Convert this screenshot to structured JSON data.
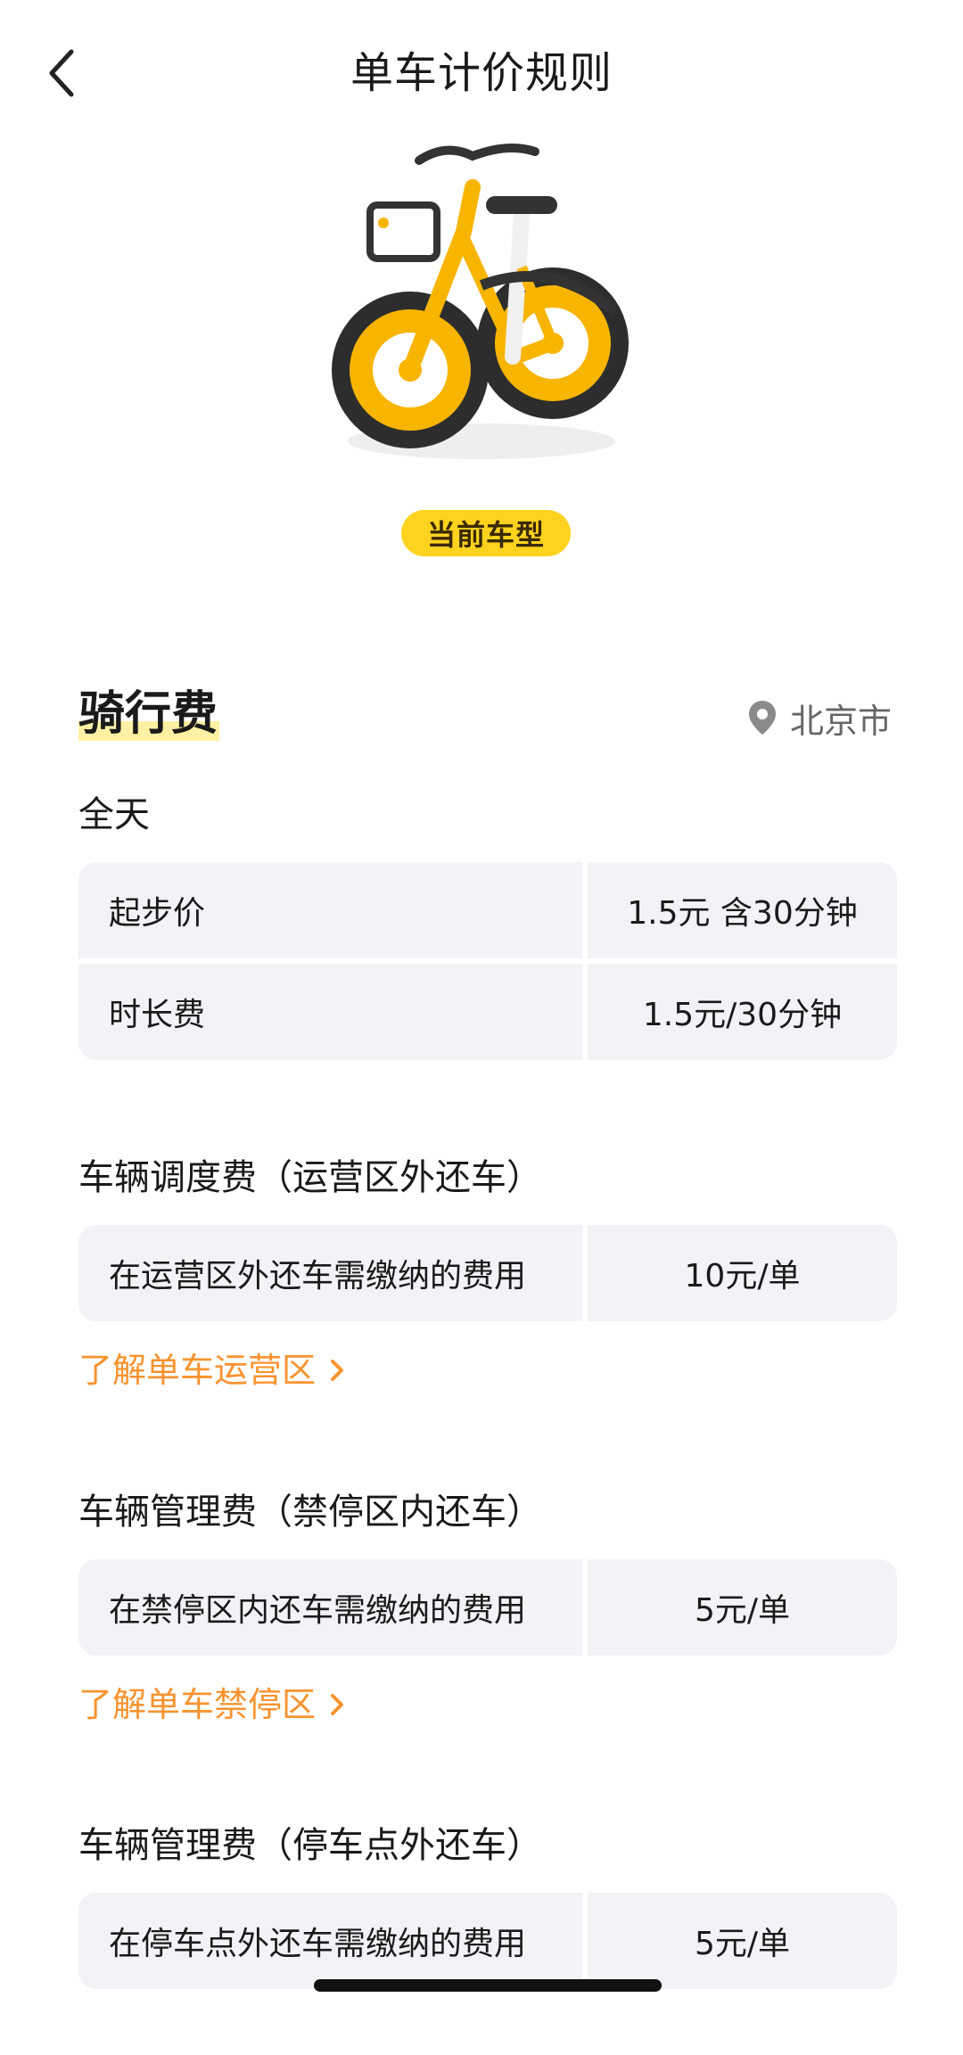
{
  "header": {
    "title": "单车计价规则",
    "back_icon": "chevron-left-icon"
  },
  "bike": {
    "badge": "当前车型",
    "accent_color": "#F7B500"
  },
  "riding": {
    "title": "骑行费",
    "location": "北京市",
    "location_icon": "map-pin-icon",
    "period": "全天",
    "rows": [
      {
        "label": "起步价",
        "value": "1.5元 含30分钟"
      },
      {
        "label": "时长费",
        "value": "1.5元/30分钟"
      }
    ]
  },
  "dispatch": {
    "title": "车辆调度费（运营区外还车）",
    "rows": [
      {
        "label": "在运营区外还车需缴纳的费用",
        "value": "10元/单"
      }
    ],
    "link": "了解单车运营区"
  },
  "no_parking": {
    "title": "车辆管理费（禁停区内还车）",
    "rows": [
      {
        "label": "在禁停区内还车需缴纳的费用",
        "value": "5元/单"
      }
    ],
    "link": "了解单车禁停区"
  },
  "outside_point": {
    "title": "车辆管理费（停车点外还车）",
    "rows": [
      {
        "label": "在停车点外还车需缴纳的费用",
        "value": "5元/单"
      }
    ]
  },
  "colors": {
    "link": "#F7932F",
    "badge": "#FFD21F",
    "cell_bg": "#F2F3F6"
  }
}
